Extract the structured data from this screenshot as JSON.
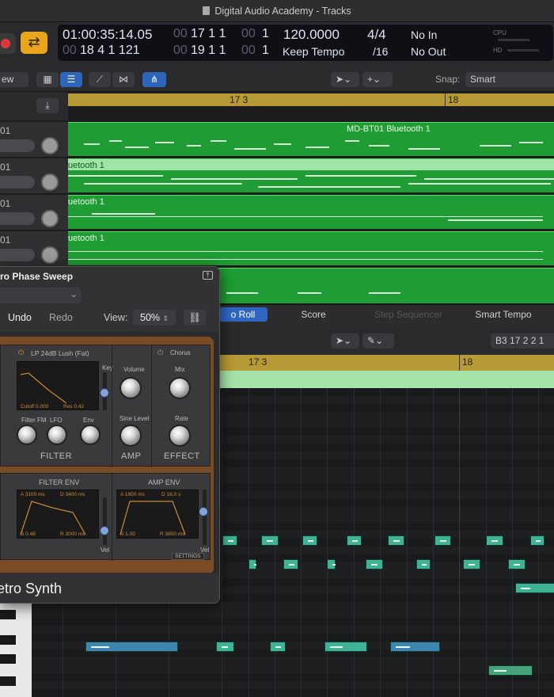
{
  "window": {
    "title": "Digital Audio Academy - Tracks"
  },
  "lcd": {
    "time": "01:00:35:14.05",
    "pos_top_dim": "00",
    "pos_top": "17 1 1",
    "pos_top_dim2": "00",
    "pos_top_end": "1",
    "pos_bottom_dim": "00",
    "pos_bottom": "18 4 1 121",
    "loc_top_dim": "00",
    "loc_top": "19 1 1",
    "loc_top_dim2": "00",
    "loc_top_end": "1",
    "tempo": "120.0000",
    "tempo_mode": "Keep Tempo",
    "sig": "4/4",
    "div": "/16",
    "in": "No In",
    "out": "No Out",
    "cpu": "CPU",
    "hd": "HD"
  },
  "toolbar": {
    "view": "ew",
    "snap_label": "Snap:",
    "snap_value": "Smart"
  },
  "ruler": {
    "bar1": "17 3",
    "bar2": "18"
  },
  "tracks": [
    {
      "num": "01",
      "region": "MD-BT01 Bluetooth 1"
    },
    {
      "num": "01",
      "region": "uetooth 1"
    },
    {
      "num": "01",
      "region": "uetooth 1"
    },
    {
      "num": "01",
      "region": "uetooth 1"
    }
  ],
  "editor": {
    "tabs": [
      "o Roll",
      "Score",
      "Step Sequencer",
      "Smart Tempo"
    ],
    "position": "B3   17 2 2 1",
    "ruler_bar1": "17 3",
    "ruler_bar2": "18"
  },
  "plugin": {
    "preset_name": "ro Phase Sweep",
    "undo": "Undo",
    "redo": "Redo",
    "view_label": "View:",
    "view_value": "50%",
    "filter_type": "LP 24dB Lush (Fat)",
    "chorus": "Chorus",
    "key": "Key",
    "cutoff": "Cutoff",
    "cutoff_val": "0.000",
    "res": "Res",
    "res_val": "0.42",
    "volume": "Volume",
    "mix": "Mix",
    "filter_fm": "Filter FM",
    "lfo": "LFO",
    "env": "Env",
    "sine_level": "Sine Level",
    "rate": "Rate",
    "filter_sect": "FILTER",
    "amp_sect": "AMP",
    "effect_sect": "EFFECT",
    "filter_env": "FILTER ENV",
    "amp_env": "AMP ENV",
    "fenv_a": "A",
    "fenv_a_val": "3100 ms",
    "fenv_d": "D",
    "fenv_d_val": "3400 ms",
    "fenv_s": "S",
    "fenv_s_val": "0.48",
    "fenv_r": "R",
    "fenv_r_val": "3000 ms",
    "aenv_a": "A",
    "aenv_a_val": "1800 ms",
    "aenv_d": "D",
    "aenv_d_val": "16.0 s",
    "aenv_s": "S",
    "aenv_s_val": "1.00",
    "aenv_r": "R",
    "aenv_r_val": "3800 ms",
    "vel": "Vel",
    "vel2": "Vel",
    "settings": "SETTINGS",
    "synth_name": "etro Synth"
  },
  "colors": {
    "region_green": "#1f9c33",
    "ruler_gold": "#b79a35",
    "note_teal": "#3fb394",
    "note_blue": "#3e86b0",
    "accent_blue": "#2f66c4",
    "cycle_yellow": "#e9a51c"
  }
}
